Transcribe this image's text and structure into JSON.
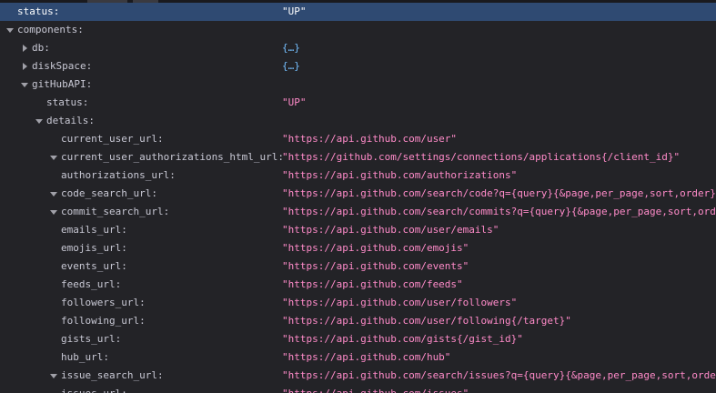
{
  "colors": {
    "background": "#232327",
    "selected_row": "#2f4a72",
    "string_value": "#ff8bc9",
    "object_value": "#75bfff",
    "key_text": "#c8c8d4"
  },
  "rows": [
    {
      "key": "status:",
      "value": "\"UP\"",
      "type": "string",
      "depth": 0,
      "twisty": "none",
      "selected": true
    },
    {
      "key": "components:",
      "value": "",
      "type": "none",
      "depth": 0,
      "twisty": "open"
    },
    {
      "key": "db:",
      "value": "{…}",
      "type": "obj",
      "depth": 1,
      "twisty": "closed"
    },
    {
      "key": "diskSpace:",
      "value": "{…}",
      "type": "obj",
      "depth": 1,
      "twisty": "closed"
    },
    {
      "key": "gitHubAPI:",
      "value": "",
      "type": "none",
      "depth": 1,
      "twisty": "open"
    },
    {
      "key": "status:",
      "value": "\"UP\"",
      "type": "string",
      "depth": 2,
      "twisty": "none"
    },
    {
      "key": "details:",
      "value": "",
      "type": "none",
      "depth": 2,
      "twisty": "open"
    },
    {
      "key": "current_user_url:",
      "value": "\"https://api.github.com/user\"",
      "type": "string",
      "depth": 3,
      "twisty": "none"
    },
    {
      "key": "current_user_authorizations_html_url:",
      "value": "\"https://github.com/settings/connections/applications{/client_id}\"",
      "type": "string",
      "depth": 3,
      "twisty": "open"
    },
    {
      "key": "authorizations_url:",
      "value": "\"https://api.github.com/authorizations\"",
      "type": "string",
      "depth": 3,
      "twisty": "none"
    },
    {
      "key": "code_search_url:",
      "value": "\"https://api.github.com/search/code?q={query}{&page,per_page,sort,order}\"",
      "type": "string",
      "depth": 3,
      "twisty": "open"
    },
    {
      "key": "commit_search_url:",
      "value": "\"https://api.github.com/search/commits?q={query}{&page,per_page,sort,order}\"",
      "type": "string",
      "depth": 3,
      "twisty": "open"
    },
    {
      "key": "emails_url:",
      "value": "\"https://api.github.com/user/emails\"",
      "type": "string",
      "depth": 3,
      "twisty": "none"
    },
    {
      "key": "emojis_url:",
      "value": "\"https://api.github.com/emojis\"",
      "type": "string",
      "depth": 3,
      "twisty": "none"
    },
    {
      "key": "events_url:",
      "value": "\"https://api.github.com/events\"",
      "type": "string",
      "depth": 3,
      "twisty": "none"
    },
    {
      "key": "feeds_url:",
      "value": "\"https://api.github.com/feeds\"",
      "type": "string",
      "depth": 3,
      "twisty": "none"
    },
    {
      "key": "followers_url:",
      "value": "\"https://api.github.com/user/followers\"",
      "type": "string",
      "depth": 3,
      "twisty": "none"
    },
    {
      "key": "following_url:",
      "value": "\"https://api.github.com/user/following{/target}\"",
      "type": "string",
      "depth": 3,
      "twisty": "none"
    },
    {
      "key": "gists_url:",
      "value": "\"https://api.github.com/gists{/gist_id}\"",
      "type": "string",
      "depth": 3,
      "twisty": "none"
    },
    {
      "key": "hub_url:",
      "value": "\"https://api.github.com/hub\"",
      "type": "string",
      "depth": 3,
      "twisty": "none"
    },
    {
      "key": "issue_search_url:",
      "value": "\"https://api.github.com/search/issues?q={query}{&page,per_page,sort,order}\"",
      "type": "string",
      "depth": 3,
      "twisty": "open"
    },
    {
      "key": "issues_url:",
      "value": "\"https://api.github.com/issues\"",
      "type": "string",
      "depth": 3,
      "twisty": "none"
    }
  ]
}
